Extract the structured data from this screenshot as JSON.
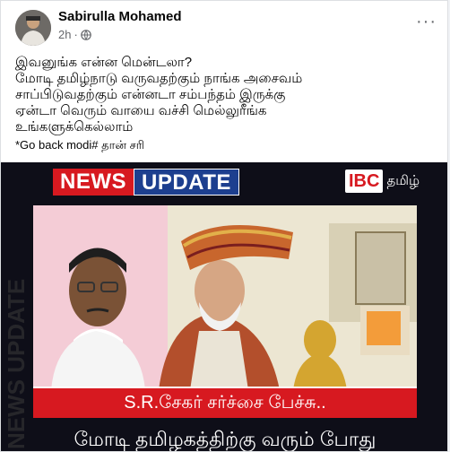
{
  "post": {
    "author": "Sabirulla Mohamed",
    "time": "2h",
    "separator": "·",
    "lines": [
      "இவனுங்க என்ன மென்டலா?",
      "மோடி தமிழ்நாடு வருவதற்கும் நாங்க அசைவம்",
      "சாப்பிடுவதற்கும் என்னடா சம்பந்தம் இருக்கு",
      "ஏன்டா வெரும் வாயை வச்சி மெல்லுரீங்க",
      "உங்களுக்கெல்லாம்"
    ],
    "hashtag_line": "*Go back modi# தான் சரி",
    "more_label": "···"
  },
  "image": {
    "news_word": "NEWS",
    "update_word": "UPDATE",
    "channel": "IBC",
    "channel_lang": "தமிழ்",
    "side_watermark": "NEWS UPDATE",
    "caption": "S.R.சேகர் சர்ச்சை பேச்சு..",
    "subcaption": "மோடி தமிழகத்திற்கு வரும் போது"
  },
  "colors": {
    "news_red": "#d71920",
    "update_blue": "#1d3f8f",
    "text_primary": "#050505",
    "text_secondary": "#65676b"
  },
  "icons": [
    "globe-icon",
    "more-options-icon"
  ]
}
